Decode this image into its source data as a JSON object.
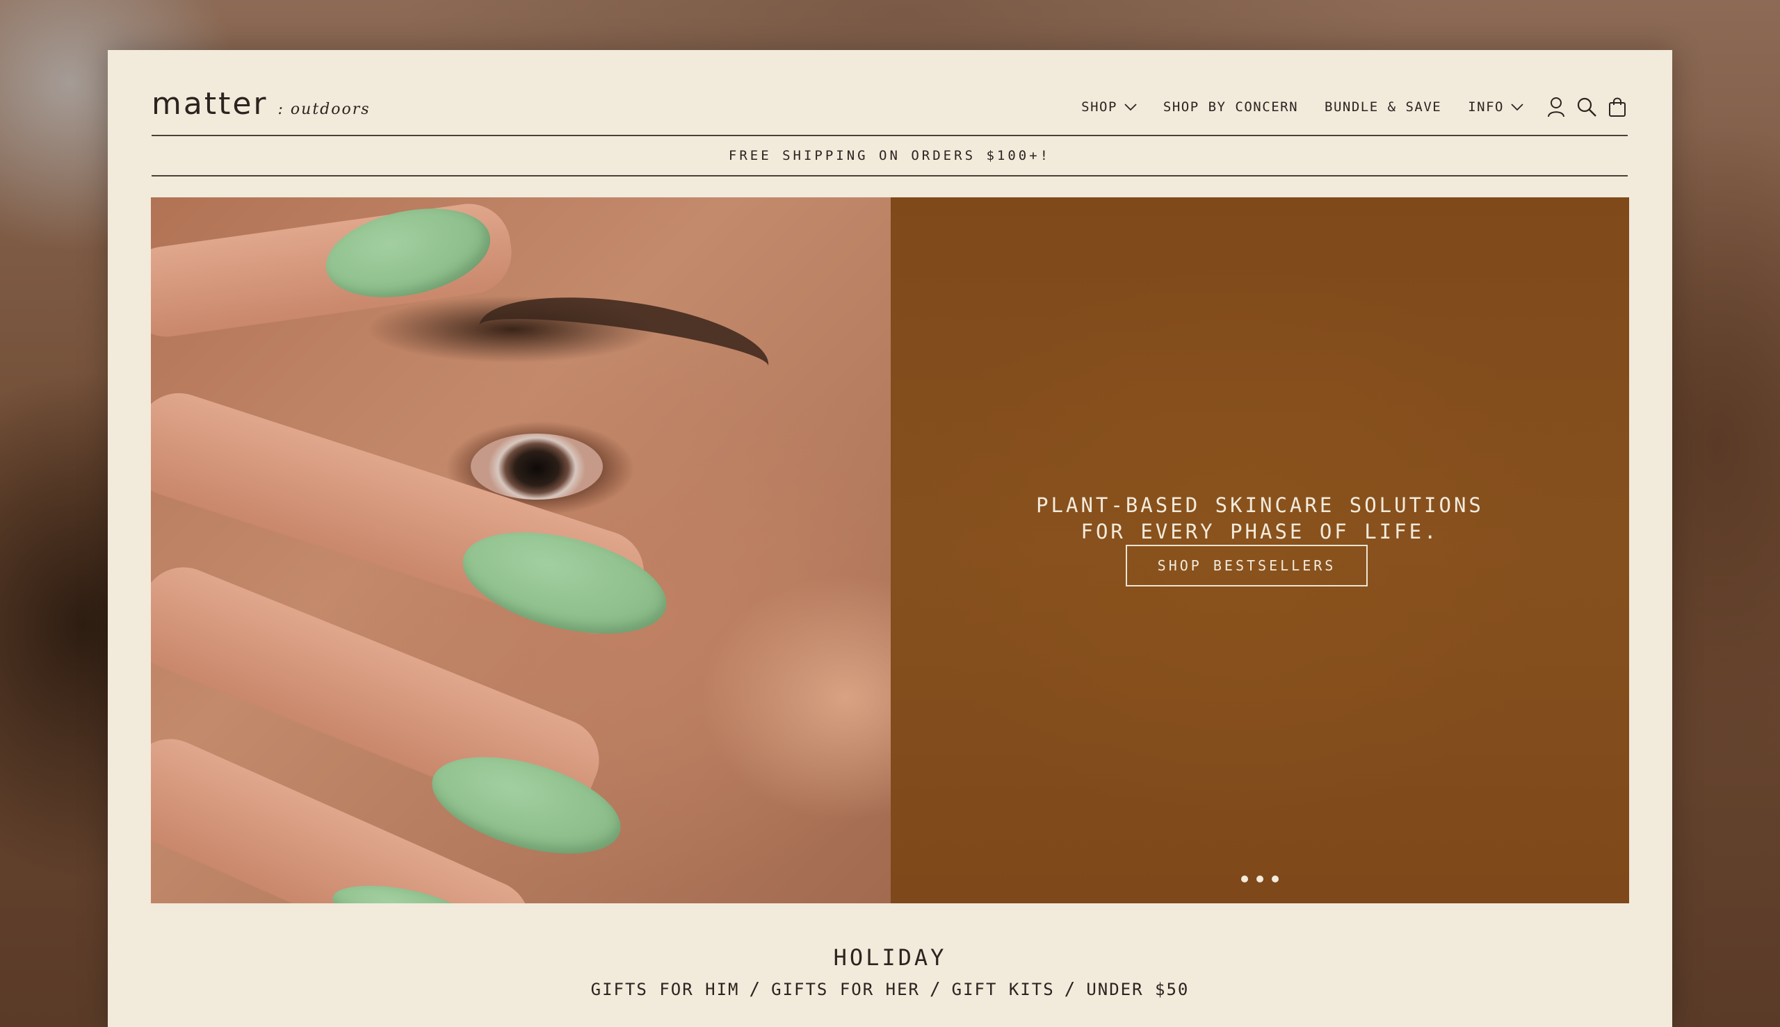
{
  "brand": {
    "name": "matter",
    "subtitle": ": outdoors"
  },
  "nav": {
    "shop": "SHOP",
    "shop_by_concern": "SHOP BY CONCERN",
    "bundle_save": "BUNDLE & SAVE",
    "info": "INFO",
    "icons": [
      "account-icon",
      "search-icon",
      "cart-icon"
    ]
  },
  "announcement": "FREE SHIPPING ON ORDERS $100+!",
  "hero": {
    "headline_line1": "PLANT-BASED SKINCARE SOLUTIONS",
    "headline_line2": "FOR EVERY PHASE OF LIFE.",
    "cta": "SHOP BESTSELLERS",
    "slide_count": 3,
    "panel_color": "#82491b",
    "nail_color": "#8fc08d"
  },
  "holiday": {
    "title": "HOLIDAY",
    "links": [
      "GIFTS FOR HIM",
      "GIFTS FOR HER",
      "GIFT KITS",
      "UNDER $50"
    ],
    "separator": "/"
  },
  "colors": {
    "page_bg": "#f2eadb",
    "text": "#2b241f"
  }
}
